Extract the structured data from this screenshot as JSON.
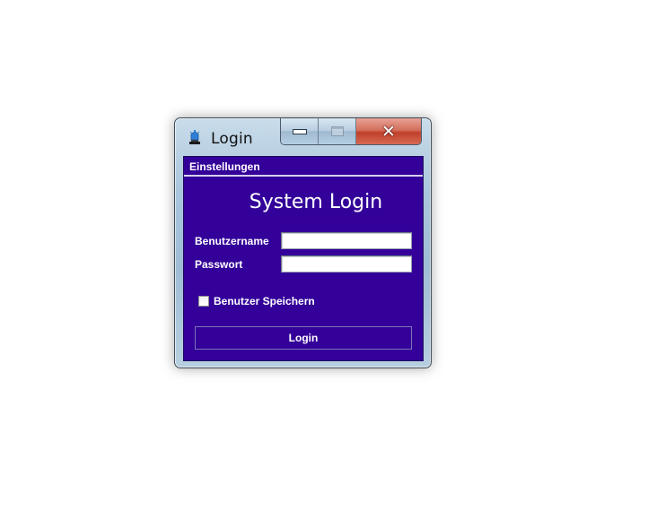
{
  "window": {
    "title": "Login",
    "icon": "app-bell-icon",
    "caption_buttons": {
      "minimize": "minimize-icon",
      "maximize": "maximize-icon",
      "close": "close-icon"
    }
  },
  "tab": {
    "label": "Einstellungen"
  },
  "form": {
    "heading": "System Login",
    "username_label": "Benutzername",
    "username_value": "",
    "password_label": "Passwort",
    "password_value": "",
    "remember_label": "Benutzer Speichern",
    "remember_checked": false,
    "login_button": "Login"
  },
  "colors": {
    "panel_background": "#330099",
    "text": "#ffffff",
    "close_button": "#c0402a"
  }
}
